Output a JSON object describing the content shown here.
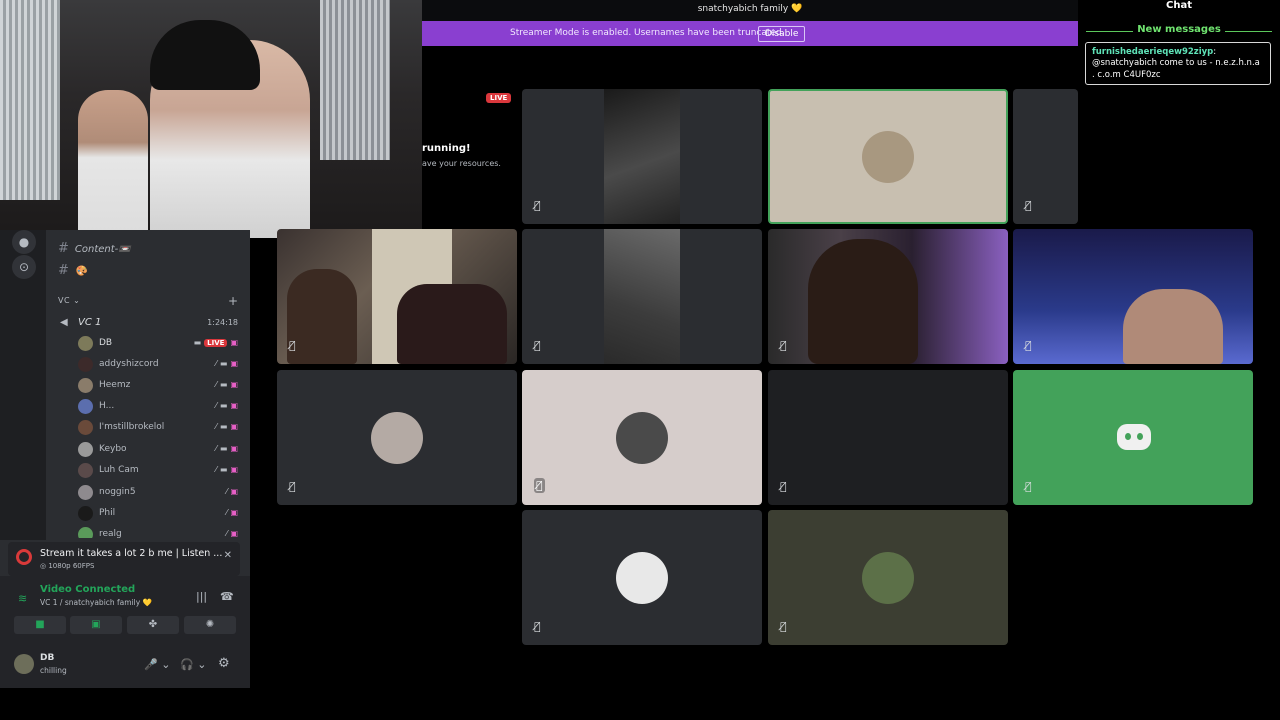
{
  "server_title": "snatchyabich family 💛",
  "streamer_banner": {
    "text": "Streamer Mode is enabled. Usernames have been truncated.",
    "button": "Disable"
  },
  "activity": {
    "live": "LIVE",
    "line1": "running!",
    "line2": "ave your resources."
  },
  "channels": [
    {
      "name": "Content-📼"
    },
    {
      "name": "🎨"
    }
  ],
  "voice_category": "VC",
  "voice_channel": {
    "name": "VC 1",
    "timer": "1:24:18"
  },
  "users": [
    {
      "name": "DB",
      "live": "LIVE",
      "color": "#7d7a5a",
      "me": true
    },
    {
      "name": "addyshizcord",
      "color": "#3c2a2a"
    },
    {
      "name": "Heemz",
      "color": "#8a7c6a"
    },
    {
      "name": "H...",
      "color": "#5b6eae"
    },
    {
      "name": "I'mstillbrokelol",
      "color": "#6a4a3a"
    },
    {
      "name": "Keybo",
      "color": "#9a9a9a"
    },
    {
      "name": "Luh Cam",
      "color": "#5a4a4a"
    },
    {
      "name": "noggin5",
      "color": "#8e8a8e"
    },
    {
      "name": "Phil",
      "color": "#1a1a1a"
    },
    {
      "name": "realg",
      "color": "#5a9a5a"
    }
  ],
  "stream": {
    "title": "Stream it takes a lot 2 b me | Listen ...",
    "quality": "1080p 60FPS"
  },
  "voice_status": {
    "status": "Video Connected",
    "sub": "VC 1 / snatchyabich family 💛"
  },
  "me": {
    "name": "DB",
    "status": "chilling"
  },
  "chat": {
    "title": "Chat",
    "new_messages": "New messages",
    "message": {
      "user": "furnishedaerieqew92ziyp",
      "text": "@snatchyabich come to us - n.e.z.h.n.a . c.o.m C4UF0zc"
    }
  },
  "tiles": [
    {
      "kind": "video"
    },
    {
      "kind": "avatar"
    },
    {
      "kind": "dark"
    },
    {
      "kind": "video"
    },
    {
      "kind": "video"
    },
    {
      "kind": "video"
    },
    {
      "kind": "video"
    },
    {
      "kind": "avatar"
    },
    {
      "kind": "avatar"
    },
    {
      "kind": "empty"
    },
    {
      "kind": "discord"
    },
    {
      "kind": "avatar"
    },
    {
      "kind": "avatar"
    }
  ]
}
